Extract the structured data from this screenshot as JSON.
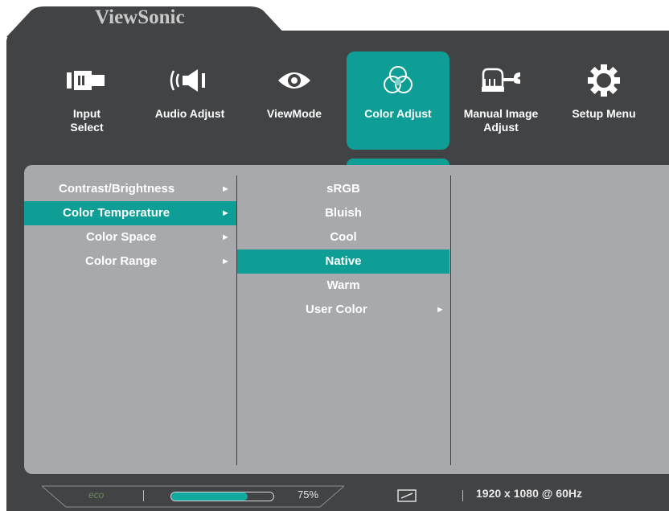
{
  "brand": {
    "name": "ViewSonic"
  },
  "main_menu": [
    {
      "label": "Input Select",
      "icon": "input-select-icon"
    },
    {
      "label": "Audio Adjust",
      "icon": "audio-speaker-icon"
    },
    {
      "label": "ViewMode",
      "icon": "eye-icon"
    },
    {
      "label": "Color Adjust",
      "icon": "color-circles-icon",
      "active": true
    },
    {
      "label": "Manual Image Adjust",
      "icon": "hand-wrench-icon"
    },
    {
      "label": "Setup Menu",
      "icon": "gear-icon"
    }
  ],
  "submenu": [
    {
      "label": "Contrast/Brightness",
      "arrow": "►"
    },
    {
      "label": "Color Temperature",
      "arrow": "►",
      "selected": true
    },
    {
      "label": "Color Space",
      "arrow": "►"
    },
    {
      "label": "Color Range",
      "arrow": "►"
    }
  ],
  "options": [
    {
      "label": "sRGB"
    },
    {
      "label": "Bluish"
    },
    {
      "label": "Cool"
    },
    {
      "label": "Native",
      "selected": true
    },
    {
      "label": "Warm"
    },
    {
      "label": "User Color",
      "arrow": "►"
    }
  ],
  "status": {
    "eco_label": "eco",
    "brightness_percent": 75,
    "brightness_text": "75%",
    "resolution": "1920 x 1080 @ 60Hz",
    "aspect_icon": "aspect-ratio-icon"
  },
  "colors": {
    "accent": "#0f9e96",
    "frame": "#414345",
    "panel": "#a7a9ac"
  }
}
